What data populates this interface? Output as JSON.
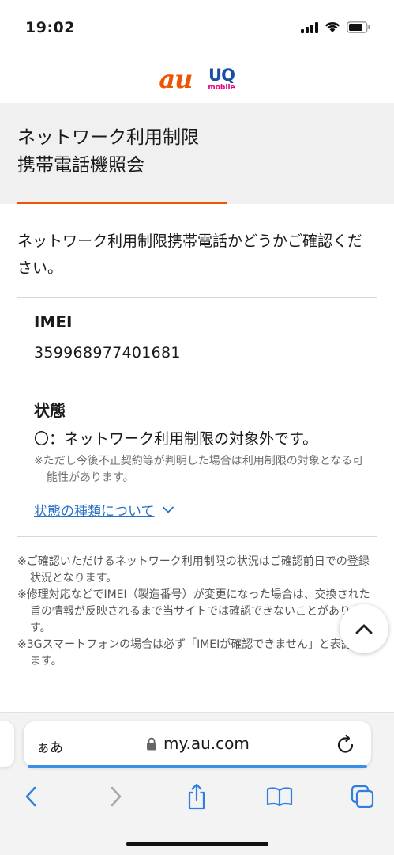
{
  "status_bar": {
    "time": "19:02"
  },
  "brand": {
    "au": "au",
    "uq_main": "UQ",
    "uq_sub": "mobile"
  },
  "page": {
    "title": "ネットワーク利用制限\n携帯電話機照会",
    "intro": "ネットワーク利用制限携帯電話かどうかご確認ください。"
  },
  "result": {
    "imei_label": "IMEI",
    "imei_value": "359968977401681",
    "status_label": "状態",
    "status_value": "〇：ネットワーク利用制限の対象外です。",
    "status_note": "※ただし今後不正契約等が判明した場合は利用制限の対象となる可能性があります。",
    "status_link": "状態の種類について"
  },
  "notes": [
    "※ご確認いただけるネットワーク利用制限の状況はご確認前日での登録状況となります。",
    "※修理対応などでIMEI（製造番号）が変更になった場合は、交換された旨の情報が反映されるまで当サイトでは確認できないことがあります。",
    "※3Gスマートフォンの場合は必ず「IMEIが確認できません」と表記されます。"
  ],
  "browser": {
    "aa_label": "ぁあ",
    "url": "my.au.com"
  },
  "colors": {
    "accent": "#eb5505",
    "link": "#2a71c5",
    "ios_blue": "#2f7fe0"
  },
  "icons": [
    "signal-icon",
    "wifi-icon",
    "battery-icon",
    "chevron-up-icon",
    "lock-icon",
    "reload-icon",
    "back-icon",
    "forward-icon",
    "share-icon",
    "bookmarks-icon",
    "tabs-icon",
    "chevron-down-icon"
  ]
}
